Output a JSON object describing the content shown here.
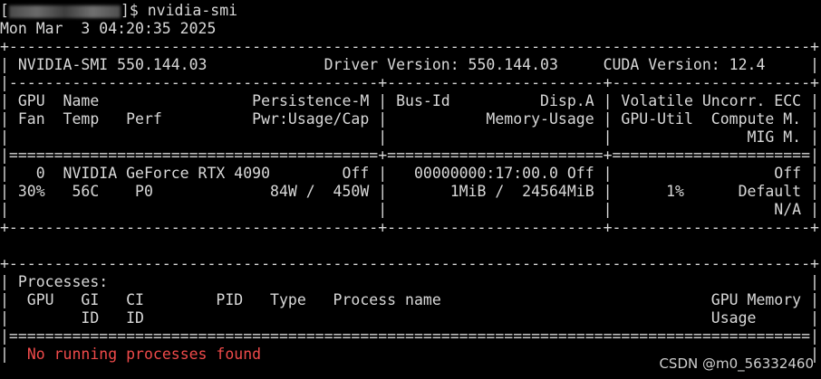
{
  "prompt": {
    "prefix": "[",
    "suffix": "]$ ",
    "command": "nvidia-smi"
  },
  "datetime": "Mon Mar  3 04:20:35 2025",
  "lines": [
    "+-----------------------------------------------------------------------------------------+",
    "| NVIDIA-SMI 550.144.03             Driver Version: 550.144.03     CUDA Version: 12.4     |",
    "|-----------------------------------------+------------------------+----------------------+",
    "| GPU  Name                 Persistence-M | Bus-Id          Disp.A | Volatile Uncorr. ECC |",
    "| Fan  Temp   Perf          Pwr:Usage/Cap |           Memory-Usage | GPU-Util  Compute M. |",
    "|                                         |                        |               MIG M. |",
    "|=========================================+========================+======================|",
    "|   0  NVIDIA GeForce RTX 4090        Off |   00000000:17:00.0 Off |                  Off |",
    "| 30%   56C    P0             84W /  450W |       1MiB /  24564MiB |      1%      Default |",
    "|                                         |                        |                  N/A |",
    "+-----------------------------------------+------------------------+----------------------+",
    "",
    "+-----------------------------------------------------------------------------------------+",
    "| Processes:                                                                              |",
    "|  GPU   GI   CI        PID   Type   Process name                              GPU Memory |",
    "|        ID   ID                                                               Usage      |",
    "|=========================================================================================|"
  ],
  "no_proc": {
    "left": "|  ",
    "text": "No running processes found",
    "right": "                                                             |"
  },
  "watermark": "CSDN @m0_56332460"
}
